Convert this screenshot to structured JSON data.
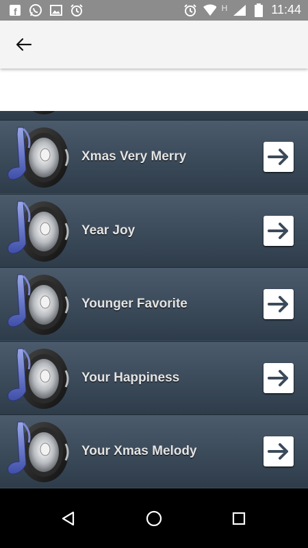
{
  "status_bar": {
    "time": "11:44",
    "network_label": "H",
    "left_icons": [
      "facebook-icon",
      "whatsapp-icon",
      "gallery-icon",
      "alarm-icon"
    ],
    "right_icons": [
      "alarm-icon",
      "wifi-icon",
      "signal-icon",
      "battery-icon"
    ]
  },
  "toolbar": {
    "back_icon": "arrow-left-icon"
  },
  "list": {
    "items": [
      {
        "title": ""
      },
      {
        "title": "Xmas Very Merry"
      },
      {
        "title": "Year Joy"
      },
      {
        "title": "Younger Favorite"
      },
      {
        "title": "Your Happiness"
      },
      {
        "title": "Your Xmas Melody"
      }
    ]
  },
  "navbar": {
    "buttons": [
      "back-triangle-icon",
      "home-circle-icon",
      "recents-square-icon"
    ]
  },
  "colors": {
    "row_bg_top": "#4b5b6c",
    "row_bg_bottom": "#2e3c4a",
    "status_bar": "#8c8c8c",
    "toolbar": "#f4f4f4"
  }
}
